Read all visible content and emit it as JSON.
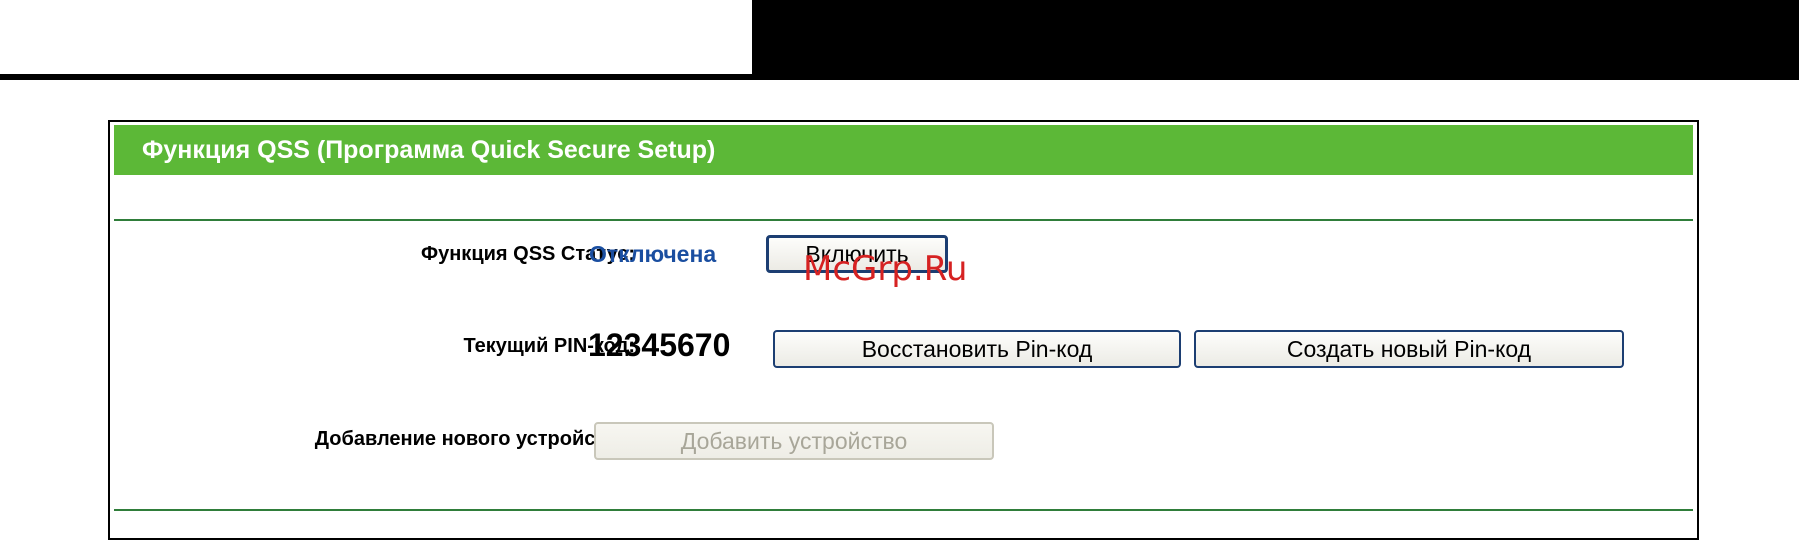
{
  "panel": {
    "title": "Функция QSS (Программа Quick Secure Setup)"
  },
  "status": {
    "label": "Функция QSS Статус:",
    "value": "Отключена",
    "enable_button": "Включить"
  },
  "pin": {
    "label": "Текущий PIN-код:",
    "value": "12345670",
    "restore_button": "Восстановить Pin-код",
    "new_button": "Создать новый Pin-код"
  },
  "add_device": {
    "label": "Добавление нового устройства:",
    "button": "Добавить устройство",
    "button_disabled": true
  },
  "watermark": "McGrp.Ru",
  "colors": {
    "header_green": "#5cb837",
    "divider_green": "#2f7d3a",
    "status_blue": "#1a4ea0",
    "watermark_red": "#d62222"
  }
}
